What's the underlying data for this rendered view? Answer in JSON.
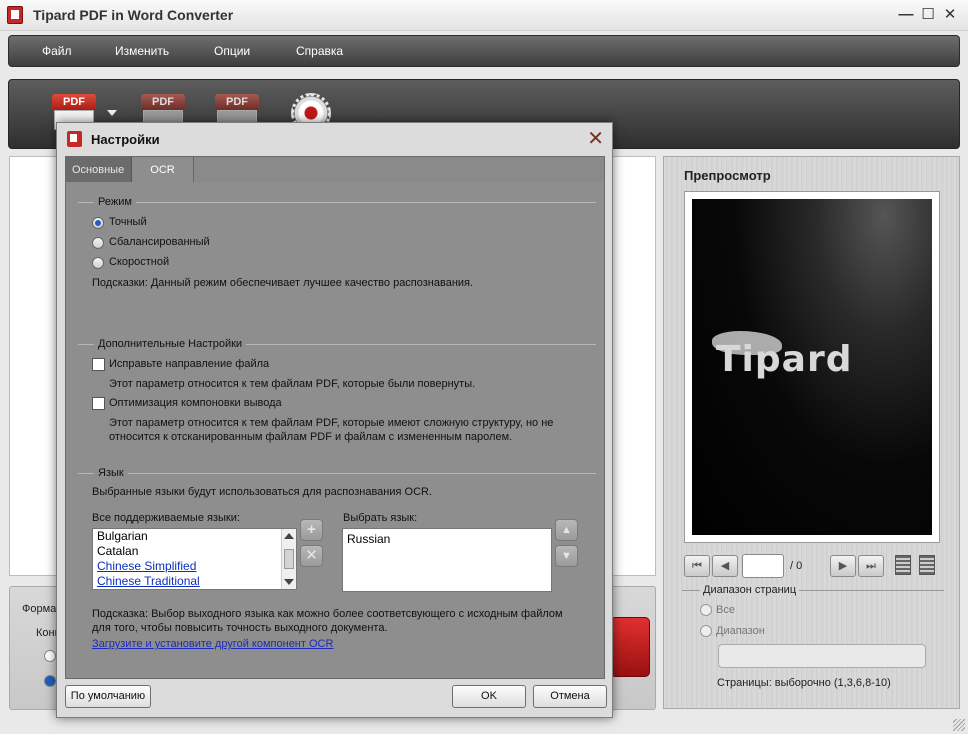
{
  "window": {
    "title": "Tipard PDF in Word Converter",
    "controls": {
      "minimize": "—",
      "maximize": "☐",
      "close": "✕"
    }
  },
  "menu": [
    "Файл",
    "Изменить",
    "Опции",
    "Справка"
  ],
  "toolbar": {
    "pdf_tag": "PDF",
    "tools": [
      {
        "name": "add-pdf-icon"
      },
      {
        "name": "edit-pdf-icon"
      },
      {
        "name": "clip-pdf-icon"
      },
      {
        "name": "settings-gear-icon"
      }
    ]
  },
  "bottom_panel": {
    "format_label": "Формат",
    "convert_label": "Конв"
  },
  "preview": {
    "title": "Препросмотр",
    "logo": "Tipard",
    "page_total": "/ 0",
    "nav": {
      "first": "⏮",
      "prev": "◀",
      "next": "▶",
      "last": "⏭"
    },
    "range_title": "Диапазон страниц",
    "range_all": "Все",
    "range_custom": "Диапазон",
    "pages_hint": "Страницы: выборочно (1,3,6,8-10)"
  },
  "dialog": {
    "title": "Настройки",
    "close": "✕",
    "tabs": {
      "basic": "Основные",
      "ocr": "OCR"
    },
    "mode": {
      "title": "Режим",
      "options": [
        "Точный",
        "Сбалансированный",
        "Скоростной"
      ],
      "selected": "Точный",
      "hint": "Подсказки:  Данный режим обеспечивает лучшее качество распознавания."
    },
    "advanced": {
      "title": "Дополнительные Настройки",
      "fix_direction": "Исправьте направление файла",
      "fix_direction_desc": "Этот параметр относится к тем файлам PDF, которые были повернуты.",
      "optimize_layout": "Оптимизация компоновки вывода",
      "optimize_layout_desc_1": "Этот параметр относится к тем файлам PDF, которые имеют сложную структуру, но не",
      "optimize_layout_desc_2": "относится к отсканированным файлам PDF и файлам с измененным паролем.",
      "fix_direction_checked": false,
      "optimize_layout_checked": false
    },
    "language": {
      "title": "Язык",
      "description": "Выбранные языки будут использоваться для распознавания OCR.",
      "all_label": "Все поддерживаемые языки:",
      "all_list": [
        {
          "label": "Bulgarian",
          "link": false
        },
        {
          "label": "Catalan",
          "link": false
        },
        {
          "label": "Chinese Simplified",
          "link": true
        },
        {
          "label": "Chinese Traditional",
          "link": true
        }
      ],
      "selected_label": "Выбрать язык:",
      "selected_list": [
        "Russian"
      ],
      "add_symbol": "+",
      "remove_symbol": "✕",
      "up_symbol": "▲",
      "down_symbol": "▼",
      "hint_1": "Подсказка:  Выбор выходного языка как можно более соответсвующего с исходным файлом",
      "hint_2": "для того, чтобы повысить точность выходного документа.",
      "download_link": "Загрузите и установите другой компонент OCR"
    },
    "buttons": {
      "default": "По умолчанию",
      "ok": "OK",
      "cancel": "Отмена"
    }
  }
}
